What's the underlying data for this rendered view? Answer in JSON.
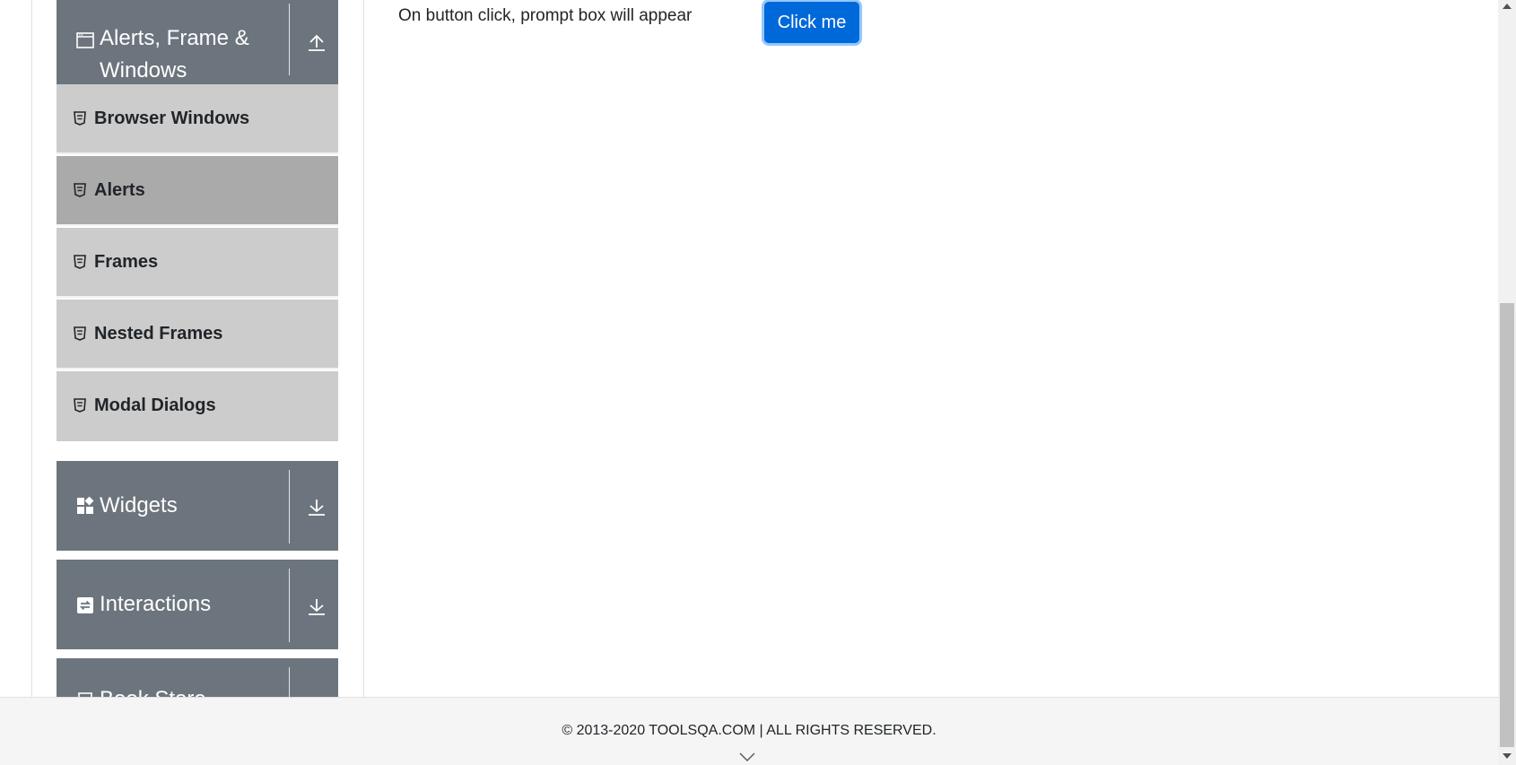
{
  "sidebar": {
    "groups": [
      {
        "title": "Alerts, Frame & Windows",
        "title_line1": "Alerts, Frame &",
        "title_line2": "Windows",
        "icon": "window-icon",
        "toggle_icon": "arrow-up-icon",
        "expanded": true
      },
      {
        "title": "Widgets",
        "icon": "widgets-icon",
        "toggle_icon": "arrow-down-icon",
        "expanded": false
      },
      {
        "title": "Interactions",
        "icon": "interactions-icon",
        "toggle_icon": "arrow-down-icon",
        "expanded": false
      },
      {
        "title": "Book Store Application",
        "icon": "book-icon",
        "toggle_icon": "arrow-down-icon",
        "expanded": false
      }
    ],
    "items": [
      {
        "label": "Browser Windows",
        "active": false
      },
      {
        "label": "Alerts",
        "active": true
      },
      {
        "label": "Frames",
        "active": false
      },
      {
        "label": "Nested Frames",
        "active": false
      },
      {
        "label": "Modal Dialogs",
        "active": false
      }
    ]
  },
  "main": {
    "prompt_text": "On button click, prompt box will appear",
    "button_label": "Click me"
  },
  "footer": {
    "copyright": "© 2013-2020 TOOLSQA.COM | ALL RIGHTS RESERVED."
  },
  "colors": {
    "group_bg": "#6c757d",
    "item_bg": "#cccccc",
    "item_active_bg": "#aaaaaa",
    "button_bg": "#0069d9",
    "footer_bg": "#f5f5f5"
  }
}
